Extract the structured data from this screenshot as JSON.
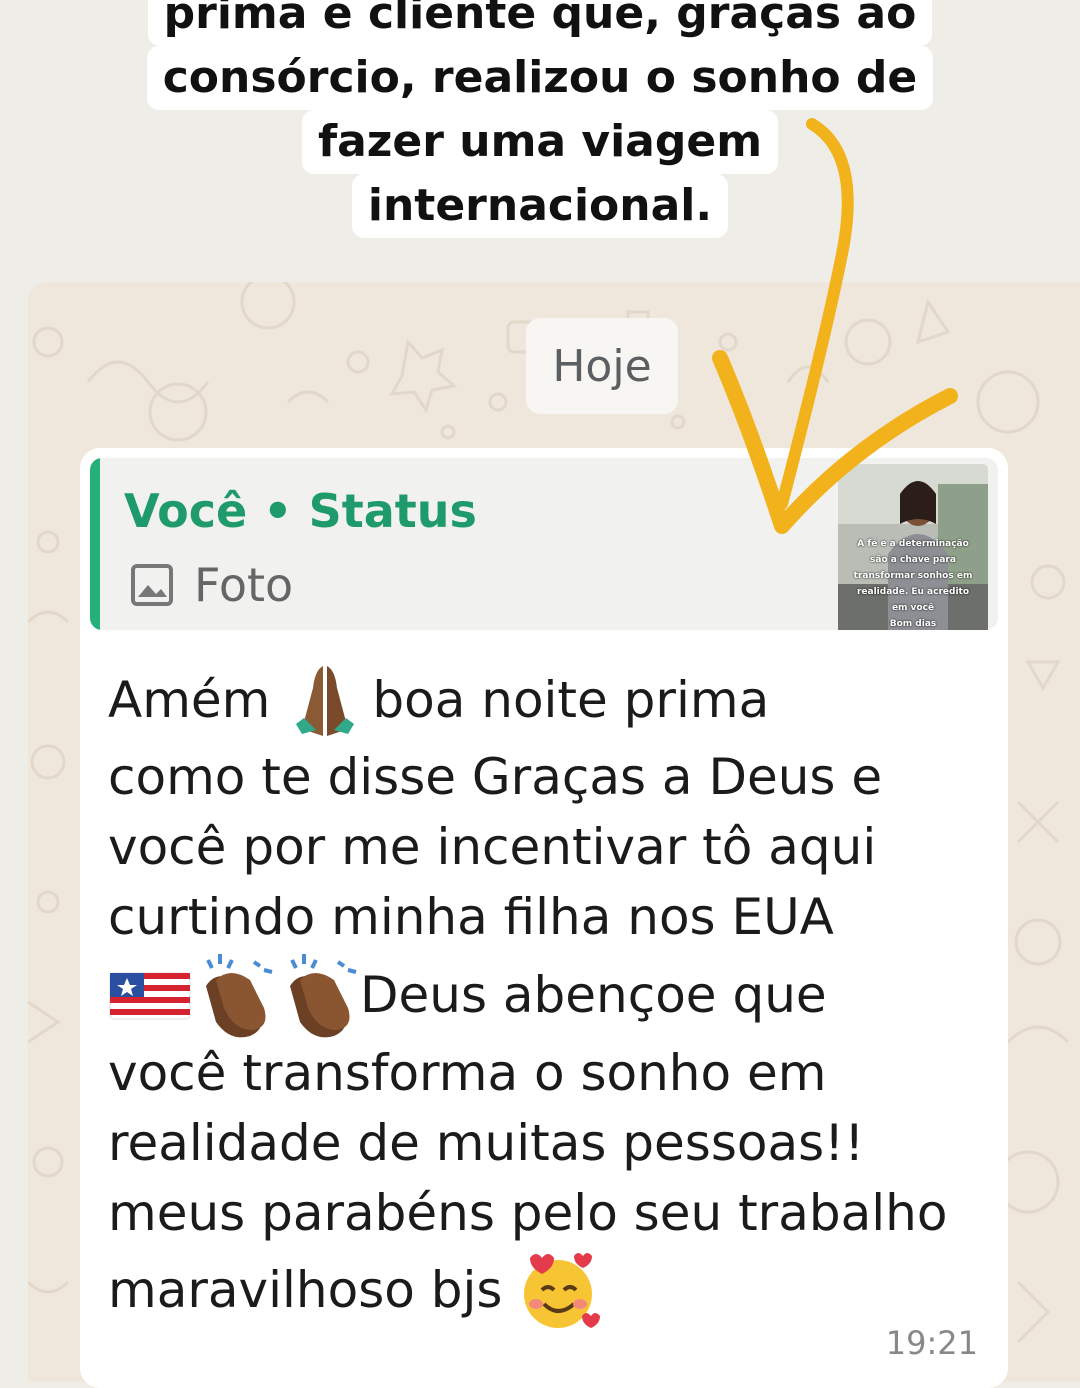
{
  "caption": {
    "lines": [
      "prima e cliente que, graças ao",
      "consórcio, realizou o sonho de",
      "fazer uma viagem",
      "internacional."
    ]
  },
  "chat": {
    "date_label": "Hoje",
    "reply": {
      "author": "Você • Status",
      "type_icon": "image-icon",
      "type_label": "Foto",
      "thumbnail_text": [
        "A fé e a determinação",
        "são a chave para",
        "transformar sonhos em",
        "realidade. Eu acredito",
        "em você",
        "Bom dias"
      ]
    },
    "message": {
      "lines": [
        {
          "before": "Amém",
          "emoji": "folded-hands-emoji",
          "after": "boa noite prima"
        },
        {
          "text": "como te disse  Graças a Deus e"
        },
        {
          "text": "você por me incentivar tô aqui"
        },
        {
          "text": "curtindo minha filha nos EUA"
        },
        {
          "emojis": [
            "flag-emoji",
            "clapping-hands-emoji",
            "clapping-hands-emoji"
          ],
          "text": "Deus abençoe que"
        },
        {
          "text": "você transforma o sonho em"
        },
        {
          "text": "realidade de muitas pessoas!!"
        },
        {
          "text": "meus parabéns pelo seu trabalho"
        },
        {
          "text": "maravilhoso bjs",
          "emoji": "smiling-face-with-hearts-emoji"
        }
      ],
      "time": "19:21"
    }
  },
  "colors": {
    "accent_green": "#1f9a6b",
    "quote_bar": "#25b07a",
    "arrow": "#f2b21b",
    "wallpaper": "#efe7dc"
  }
}
